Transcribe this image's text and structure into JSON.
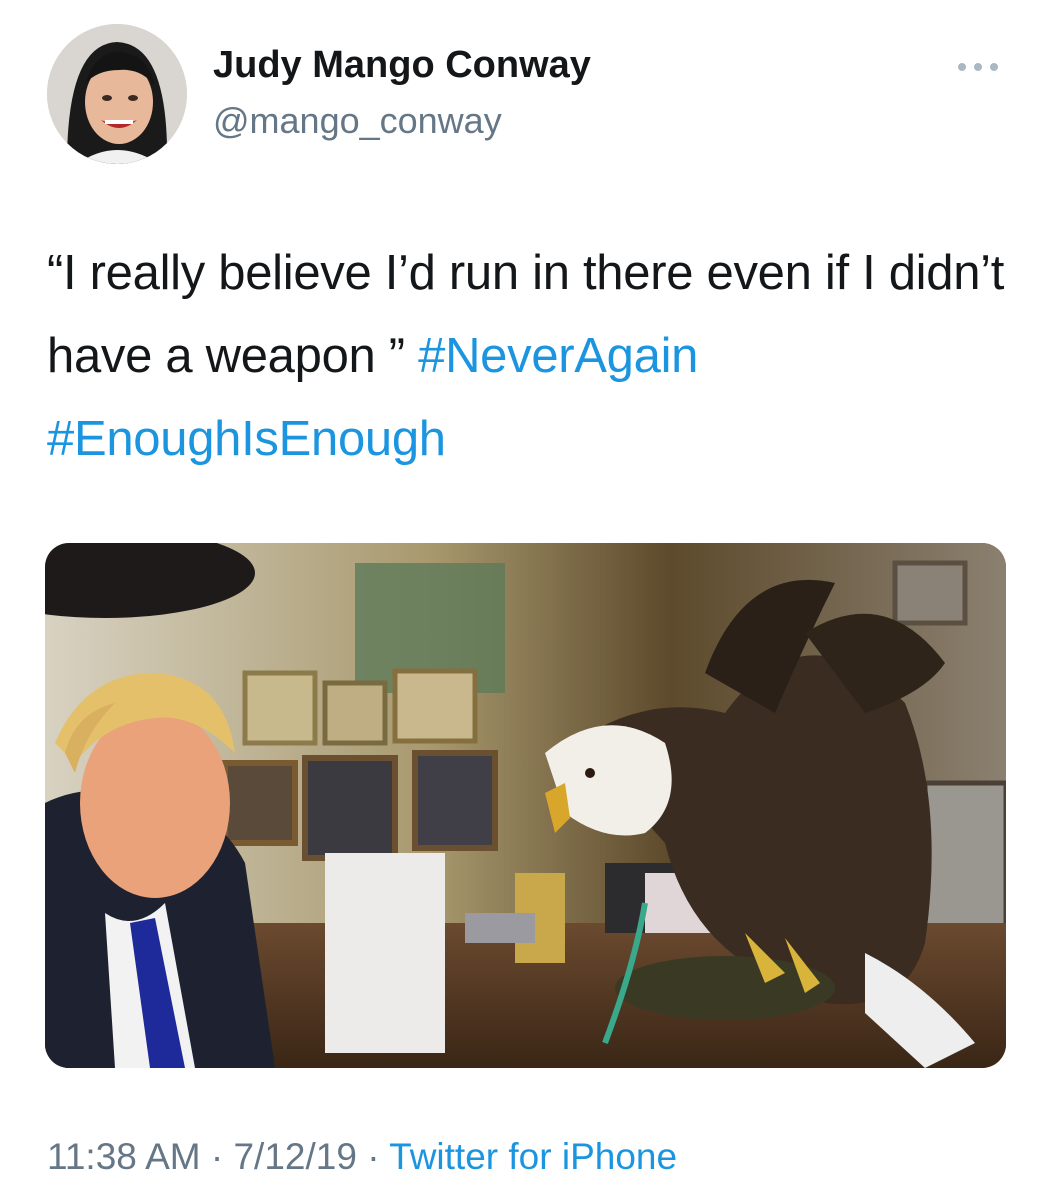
{
  "author": {
    "display_name": "Judy Mango Conway",
    "handle": "@mango_conway",
    "avatar_icon": "profile-photo"
  },
  "tweet": {
    "text_part1": "“I really believe I’d run in there even if I didn’t have a weapon ” ",
    "hashtags": [
      "#NeverAgain",
      "#EnoughIsEnough"
    ]
  },
  "media": {
    "type": "photo",
    "icon": "embedded-photo"
  },
  "meta": {
    "time": "11:38 AM",
    "separator": " · ",
    "date": "7/12/19",
    "source": "Twitter for iPhone"
  },
  "colors": {
    "link": "#1b95e0",
    "secondary_text": "#657786",
    "primary_text": "#14171a"
  }
}
